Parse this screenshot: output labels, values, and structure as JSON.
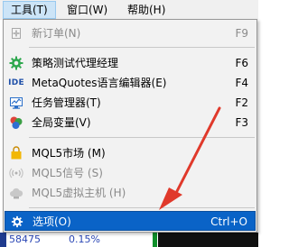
{
  "menubar": {
    "tools": "工具(T)",
    "window": "窗口(W)",
    "help": "帮助(H)"
  },
  "menu": {
    "items": [
      {
        "label": "新订单(N)",
        "shortcut": "F9",
        "icon": "new-order-icon",
        "disabled": true
      },
      {
        "label": "策略测试代理经理",
        "shortcut": "F6",
        "icon": "gear-icon"
      },
      {
        "label": "MetaQuotes语言编辑器(E)",
        "shortcut": "F4",
        "icon": "ide-icon",
        "icon_text": "IDE"
      },
      {
        "label": "任务管理器(T)",
        "shortcut": "F2",
        "icon": "monitor-icon"
      },
      {
        "label": "全局变量(V)",
        "shortcut": "F3",
        "icon": "variables-icon"
      },
      {
        "label": "MQL5市场 (M)",
        "shortcut": "",
        "icon": "shopping-bag-icon"
      },
      {
        "label": "MQL5信号 (S)",
        "shortcut": "",
        "icon": "signal-icon",
        "disabled": true
      },
      {
        "label": "MQL5虚拟主机 (H)",
        "shortcut": "",
        "icon": "cloud-icon",
        "disabled": true
      },
      {
        "label": "选项(O)",
        "shortcut": "Ctrl+O",
        "icon": "settings-icon",
        "selected": true
      }
    ]
  },
  "background": {
    "left_value": "58475",
    "percent_value": "0.15%"
  },
  "colors": {
    "highlight": "#0a63c7",
    "arrow": "#e0392b",
    "menubar_active": "#cce4f7"
  }
}
